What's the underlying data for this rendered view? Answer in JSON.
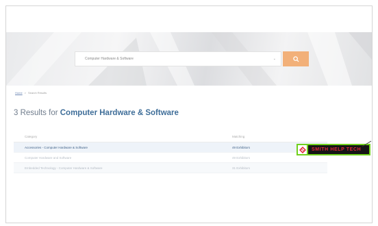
{
  "search": {
    "value": "Computer Hardware & Software",
    "caret": "⌄",
    "button_icon": "search-icon"
  },
  "breadcrumb": {
    "home": "Home",
    "separator": ">",
    "current": "Search Results"
  },
  "results": {
    "prefix": "3 Results for ",
    "query": "Computer Hardware & Software"
  },
  "table": {
    "headers": {
      "category": "Category",
      "matching": "Matching"
    },
    "rows": [
      {
        "category": "Accessories - Computer Hardware & Software",
        "matching": "49 Exhibitors"
      },
      {
        "category": "Computer Hardware and Software",
        "matching": "49 Exhibitors"
      },
      {
        "category": "Embedded Technology - Computer Hardware & Software",
        "matching": "31 Exhibitors"
      }
    ]
  },
  "watermark": {
    "text": "SMITH HELP TECH",
    "icon": "logo-emblem-icon"
  },
  "colors": {
    "accent_button": "#f2b079",
    "heading_bold": "#3f6e99",
    "logo_border": "#70d01c",
    "logo_text": "#e12b3a"
  }
}
